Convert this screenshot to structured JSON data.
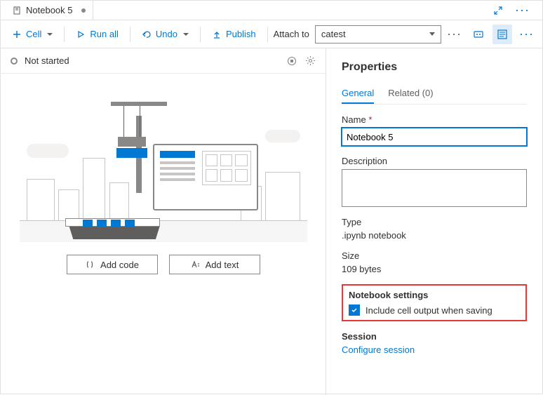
{
  "tab": {
    "title": "Notebook 5"
  },
  "toolbar": {
    "cell_label": "Cell",
    "runall_label": "Run all",
    "undo_label": "Undo",
    "publish_label": "Publish",
    "attach_label": "Attach to",
    "attach_value": "catest"
  },
  "status": {
    "text": "Not started"
  },
  "buttons": {
    "add_code": "Add code",
    "add_text": "Add text"
  },
  "properties": {
    "panel_title": "Properties",
    "tabs": {
      "general": "General",
      "related": "Related (0)"
    },
    "name_label": "Name",
    "name_value": "Notebook 5",
    "description_label": "Description",
    "description_value": "",
    "type_label": "Type",
    "type_value": ".ipynb notebook",
    "size_label": "Size",
    "size_value": "109 bytes",
    "settings_label": "Notebook settings",
    "include_output_label": "Include cell output when saving",
    "session_label": "Session",
    "configure_session": "Configure session"
  }
}
